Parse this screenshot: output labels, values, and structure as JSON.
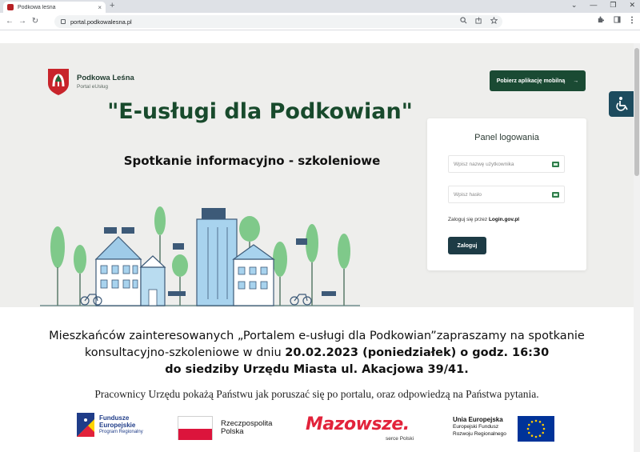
{
  "browser": {
    "tab_title": "Podkowa leśna",
    "tab_close": "×",
    "new_tab": "+",
    "window_controls": [
      "⌄",
      "—",
      "❐",
      "✕"
    ],
    "url": "portal.podkowalesna.pl",
    "nav": {
      "back": "←",
      "forward": "→",
      "reload": "↻"
    }
  },
  "header": {
    "logo_title": "Podkowa Leśna",
    "logo_subtitle": "Portal eUsług",
    "mobile_app_label": "Pobierz aplikację mobilną",
    "mobile_app_arrow": "→"
  },
  "hero": {
    "title": "\"E-usługi dla Podkowian\"",
    "subtitle": "Spotkanie informacyjno - szkoleniowe"
  },
  "login": {
    "title": "Panel logowania",
    "username_placeholder": "Wpisz nazwę użytkownika",
    "password_placeholder": "Wpisz hasło",
    "gov_prefix": "Zaloguj się przez",
    "gov_link": "Login.gov.pl",
    "submit_label": "Zaloguj"
  },
  "announcement": {
    "line1": "Mieszkańców zainteresowanych „Portalem e-usługi dla Podkowian”zapraszamy na spotkanie",
    "line2_prefix": "konsultacyjno-szkoleniowe w dniu ",
    "line2_bold": "20.02.2023 (poniedziałek) o godz. 16:30",
    "line3": "do siedziby Urzędu Miasta ul. Akacjowa 39/41.",
    "info": "Pracownicy Urzędu pokażą Państwu jak poruszać się po portalu, oraz odpowiedzą na Państwa pytania."
  },
  "footer": {
    "fe_line1": "Fundusze",
    "fe_line2": "Europejskie",
    "fe_line3": "Program Regionalny",
    "rp_line1": "Rzeczpospolita",
    "rp_line2": "Polska",
    "mazowsze": "Mazowsze.",
    "mazowsze_sub": "serce Polski",
    "ue_line1": "Unia Europejska",
    "ue_line2": "Europejski Fundusz",
    "ue_line3": "Rozwoju Regionalnego"
  },
  "colors": {
    "brand_green": "#1a4a33",
    "title_green": "#184a2c",
    "login_button": "#1d3b45",
    "accessibility": "#1d4b5e",
    "hero_background": "#eeeeec"
  }
}
